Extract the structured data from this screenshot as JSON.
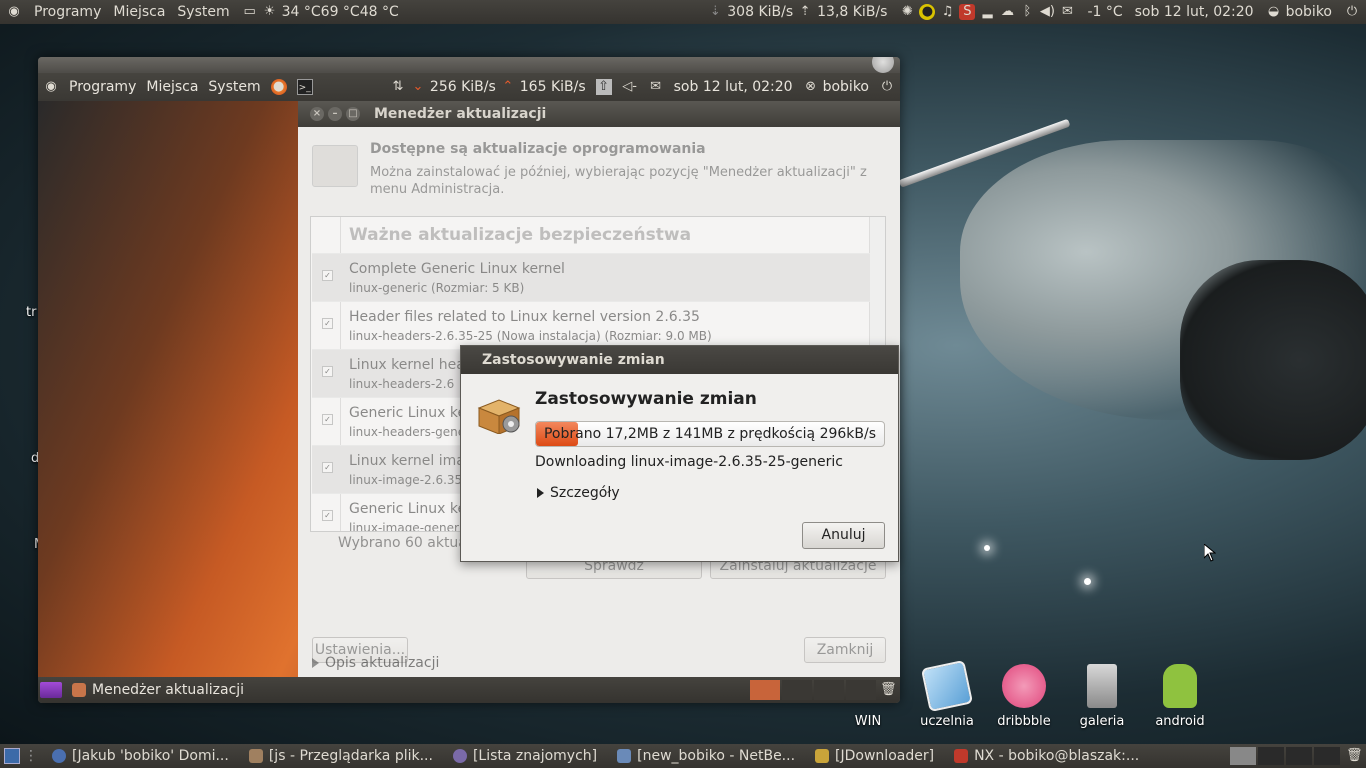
{
  "top_panel": {
    "menus": [
      "Programy",
      "Miejsca",
      "System"
    ],
    "weather": "34 °C69 °C48 °C",
    "net_down": "308 KiB/s",
    "net_up": "13,8 KiB/s",
    "temperature": "-1 °C",
    "clock": "sob 12 lut, 02:20",
    "user": "bobiko"
  },
  "inner_panel": {
    "menus": [
      "Programy",
      "Miejsca",
      "System"
    ],
    "net_down": "256 KiB/s",
    "net_up": "165 KiB/s",
    "clock": "sob 12 lut, 02:20",
    "user": "bobiko"
  },
  "update_manager": {
    "title": "Menedżer aktualizacji",
    "heading": "Dostępne są aktualizacje oprogramowania",
    "subtext": "Można zainstalować je później, wybierając pozycję \"Menedżer aktualizacji\" z menu Administracja.",
    "category": "Ważne aktualizacje bezpieczeństwa",
    "items": [
      {
        "name": "Complete Generic Linux kernel",
        "sub": "linux-generic (Rozmiar: 5 KB)"
      },
      {
        "name": "Header files related to Linux kernel version 2.6.35",
        "sub": "linux-headers-2.6.35-25 (Nowa instalacja) (Rozmiar: 9.0 MB)"
      },
      {
        "name": "Linux kernel hea",
        "sub": "linux-headers-2.6"
      },
      {
        "name": "Generic Linux ke",
        "sub": "linux-headers-gener"
      },
      {
        "name": "Linux kernel ima",
        "sub": "linux-image-2.6.35-"
      },
      {
        "name": "Generic Linux ke",
        "sub": "linux-image-generic"
      }
    ],
    "selected_count": "Wybrano 60 aktua",
    "check_button": "Sprawdź",
    "install_button": "Zainstaluj aktualizacje",
    "description_toggle": "Opis aktualizacji",
    "settings_button": "Ustawienia...",
    "close_button": "Zamknij"
  },
  "dialog": {
    "title": "Zastosowywanie zmian",
    "heading": "Zastosowywanie zmian",
    "progress_text": "Pobrano 17,2MB z 141MB z prędkością 296kB/s",
    "progress_fraction": 0.12,
    "status": "Downloading linux-image-2.6.35-25-generic",
    "details": "Szczegóły",
    "cancel": "Anuluj"
  },
  "inner_taskbar": {
    "task": "Menedżer aktualizacji"
  },
  "desktop_icons": [
    {
      "label": "WIN"
    },
    {
      "label": "uczelnia"
    },
    {
      "label": "dribbble"
    },
    {
      "label": "galeria"
    },
    {
      "label": "android"
    }
  ],
  "bottom_panel": {
    "tasks": [
      "[Jakub 'bobiko' Domi...",
      "[js - Przeglądarka plik...",
      "[Lista znajomych]",
      "[new_bobiko - NetBe...",
      "[JDownloader]",
      "NX - bobiko@blaszak:..."
    ]
  },
  "left_fragments": [
    "tr",
    "d",
    "M"
  ]
}
